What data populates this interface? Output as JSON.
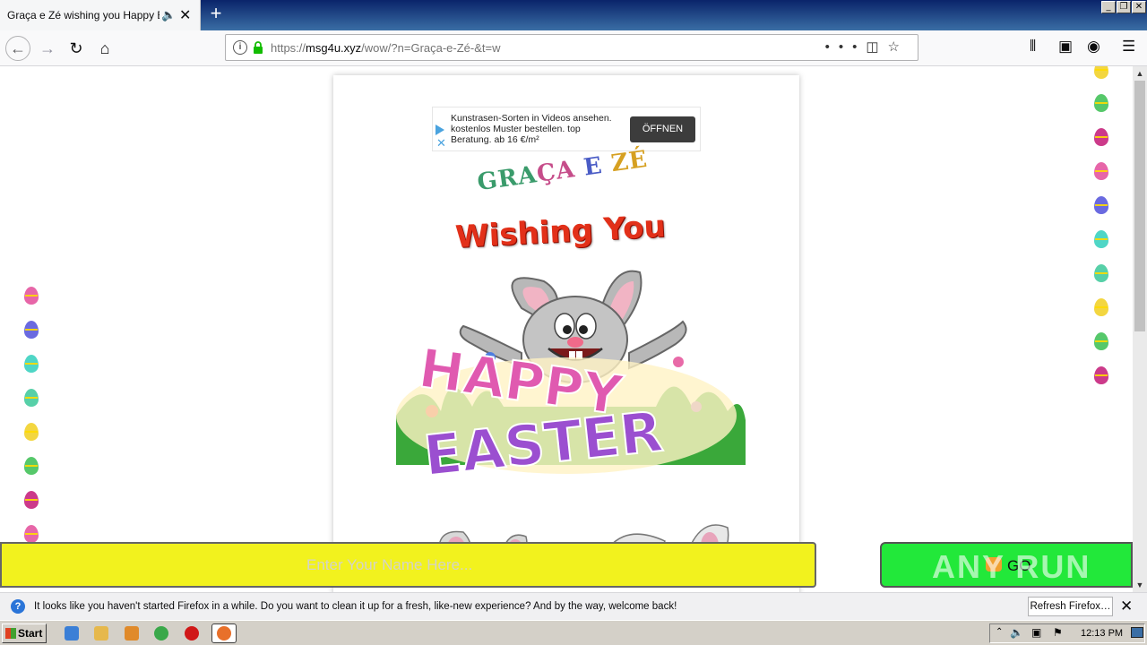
{
  "browser": {
    "tab_title": "Graça e Zé wishing you Happy Easter",
    "tab_audio_icon": "speaker-icon",
    "new_tab_label": "+",
    "url_scheme": "https://",
    "url_host": "msg4u.xyz",
    "url_path": "/wow/?n=Graça-e-Zé-&t=w",
    "url_more": "•••"
  },
  "page": {
    "ad": {
      "text": "Kunstrasen-Sorten in Videos ansehen. kostenlos Muster bestellen. top Beratung. ab 16 €/m²",
      "button": "ÖFFNEN",
      "close": "✕"
    },
    "names_parts": [
      "GRA",
      "ÇA ",
      "E ",
      "ZÉ"
    ],
    "wishing": "Wishing You",
    "happy": "HAPPY",
    "easter": "EASTER",
    "name_placeholder": "Enter Your Name Here...",
    "go_label": "GO",
    "watermark": "ANY RUN"
  },
  "notification": {
    "text": "It looks like you haven't started Firefox in a while. Do you want to clean it up for a fresh, like-new experience? And by the way, welcome back!",
    "button": "Refresh Firefox…",
    "close": "✕"
  },
  "taskbar": {
    "start": "Start",
    "clock": "12:13 PM"
  },
  "colors": {
    "name_bar": "#f2f21e",
    "go_bar": "#22e83a",
    "wishing": "#e23019"
  }
}
